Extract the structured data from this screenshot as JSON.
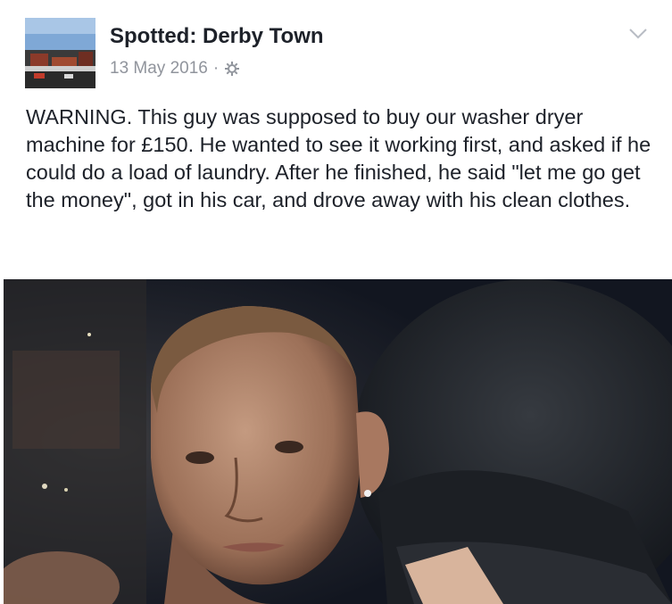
{
  "post": {
    "page_name": "Spotted: Derby Town",
    "date": "13 May 2016",
    "separator": "·",
    "body": "WARNING. This guy was supposed to buy our washer dryer machine for £150. He wanted to see it working first, and asked if he could do a load of laundry. After he finished, he said \"let me go get the money\", got in his car, and drove away with his clean clothes.",
    "icons": {
      "audience": "gear-icon",
      "options": "chevron-down-icon"
    }
  },
  "colors": {
    "name_text": "#1d2129",
    "meta_text": "#90949c",
    "body_text": "#1d2129",
    "photo_background": "#141820"
  }
}
